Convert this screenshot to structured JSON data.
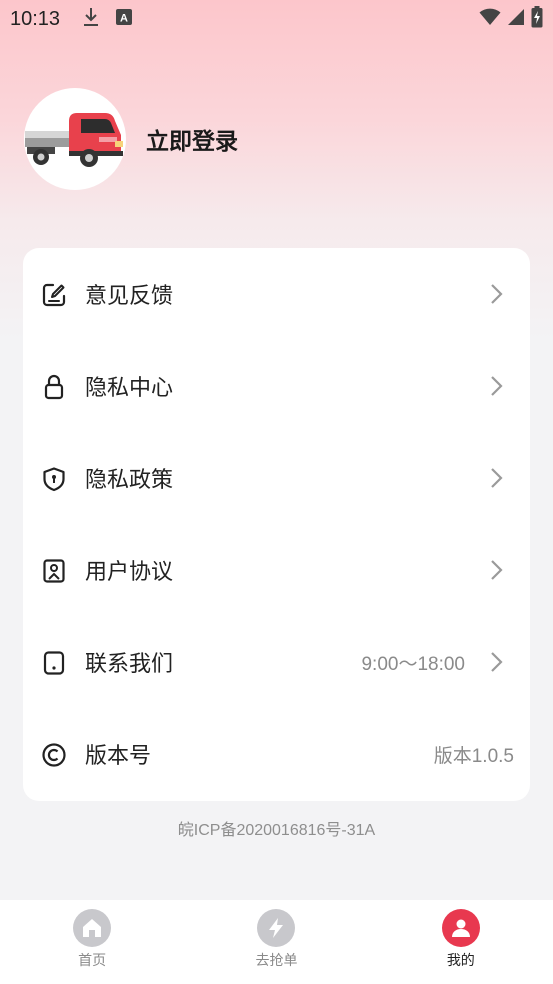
{
  "status_bar": {
    "time": "10:13"
  },
  "profile": {
    "login_label": "立即登录",
    "avatar_icon": "truck-avatar"
  },
  "menu": {
    "items": [
      {
        "label": "意见反馈",
        "icon": "feedback-edit-icon",
        "value": ""
      },
      {
        "label": "隐私中心",
        "icon": "lock-icon",
        "value": ""
      },
      {
        "label": "隐私政策",
        "icon": "shield-icon",
        "value": ""
      },
      {
        "label": "用户协议",
        "icon": "agreement-icon",
        "value": ""
      },
      {
        "label": "联系我们",
        "icon": "phone-icon",
        "value": "9:00～18:00"
      },
      {
        "label": "版本号",
        "icon": "copyright-icon",
        "value": "版本1.0.5"
      }
    ]
  },
  "icp": "皖ICP备2020016816号-31A",
  "tabbar": {
    "items": [
      {
        "label": "首页",
        "icon": "home-icon",
        "active": false
      },
      {
        "label": "去抢单",
        "icon": "lightning-icon",
        "active": false
      },
      {
        "label": "我的",
        "icon": "user-icon",
        "active": true
      }
    ]
  },
  "colors": {
    "accent": "#e8384f",
    "inactive_tab": "#c8c8cc",
    "gradient_top": "#fcc6cb"
  }
}
